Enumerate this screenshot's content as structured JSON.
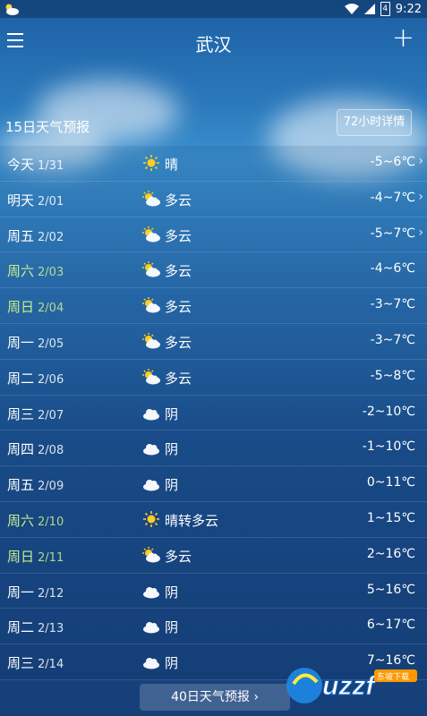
{
  "status": {
    "time": "9:22",
    "battery": "4"
  },
  "header": {
    "city": "武汉"
  },
  "forecast": {
    "title": "15日天气预报",
    "hourly_label": "72小时详情"
  },
  "days": [
    {
      "day": "今天",
      "date": "1/31",
      "icon": "sun",
      "cond": "晴",
      "temp": "-5~6℃",
      "weekend": false,
      "chevron": true
    },
    {
      "day": "明天",
      "date": "2/01",
      "icon": "partly-cloudy",
      "cond": "多云",
      "temp": "-4~7℃",
      "weekend": false,
      "chevron": true
    },
    {
      "day": "周五",
      "date": "2/02",
      "icon": "partly-cloudy",
      "cond": "多云",
      "temp": "-5~7℃",
      "weekend": false,
      "chevron": true
    },
    {
      "day": "周六",
      "date": "2/03",
      "icon": "partly-cloudy",
      "cond": "多云",
      "temp": "-4~6℃",
      "weekend": true,
      "chevron": false
    },
    {
      "day": "周日",
      "date": "2/04",
      "icon": "partly-cloudy",
      "cond": "多云",
      "temp": "-3~7℃",
      "weekend": true,
      "chevron": false
    },
    {
      "day": "周一",
      "date": "2/05",
      "icon": "partly-cloudy",
      "cond": "多云",
      "temp": "-3~7℃",
      "weekend": false,
      "chevron": false
    },
    {
      "day": "周二",
      "date": "2/06",
      "icon": "partly-cloudy",
      "cond": "多云",
      "temp": "-5~8℃",
      "weekend": false,
      "chevron": false
    },
    {
      "day": "周三",
      "date": "2/07",
      "icon": "cloud",
      "cond": "阴",
      "temp": "-2~10℃",
      "weekend": false,
      "chevron": false
    },
    {
      "day": "周四",
      "date": "2/08",
      "icon": "cloud",
      "cond": "阴",
      "temp": "-1~10℃",
      "weekend": false,
      "chevron": false
    },
    {
      "day": "周五",
      "date": "2/09",
      "icon": "cloud",
      "cond": "阴",
      "temp": "0~11℃",
      "weekend": false,
      "chevron": false
    },
    {
      "day": "周六",
      "date": "2/10",
      "icon": "sun",
      "cond": "晴转多云",
      "temp": "1~15℃",
      "weekend": true,
      "chevron": false
    },
    {
      "day": "周日",
      "date": "2/11",
      "icon": "partly-cloudy",
      "cond": "多云",
      "temp": "2~16℃",
      "weekend": true,
      "chevron": false
    },
    {
      "day": "周一",
      "date": "2/12",
      "icon": "cloud",
      "cond": "阴",
      "temp": "5~16℃",
      "weekend": false,
      "chevron": false
    },
    {
      "day": "周二",
      "date": "2/13",
      "icon": "cloud",
      "cond": "阴",
      "temp": "6~17℃",
      "weekend": false,
      "chevron": false
    },
    {
      "day": "周三",
      "date": "2/14",
      "icon": "cloud",
      "cond": "阴",
      "temp": "7~16℃",
      "weekend": false,
      "chevron": false
    }
  ],
  "footer": {
    "forty_day_label": "40日天气预报 ›"
  },
  "watermark": {
    "text": "uzzf",
    "subtext": "东坡下载"
  },
  "colors": {
    "sun": "#ffcc22",
    "weekend": "#c8f08a"
  }
}
